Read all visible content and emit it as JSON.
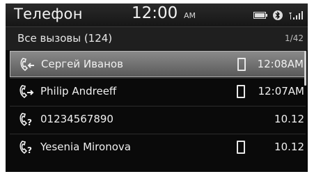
{
  "header": {
    "app_title": "Телефон",
    "time": "12:00",
    "ampm": "AM",
    "status_icons": [
      "battery-icon",
      "bluetooth-icon",
      "signal-icon"
    ]
  },
  "list": {
    "title": "Все вызовы (124)",
    "page": "1/42"
  },
  "calls": [
    {
      "name": "Сергей Иванов",
      "type": "incoming",
      "icon": "incoming-call-icon",
      "device": true,
      "time": "12:08AM",
      "selected": true
    },
    {
      "name": "Philip Andreeff",
      "type": "outgoing",
      "icon": "outgoing-call-icon",
      "device": true,
      "time": "12:07AM",
      "selected": false
    },
    {
      "name": "01234567890",
      "type": "missed",
      "icon": "missed-call-icon",
      "device": false,
      "time": "10.12",
      "selected": false
    },
    {
      "name": "Yesenia Mironova",
      "type": "missed",
      "icon": "missed-call-icon",
      "device": true,
      "time": "10.12",
      "selected": false
    }
  ],
  "colors": {
    "screen_bg": "#0a0a0a",
    "subheader_bg": "#1f1f1f",
    "selected_row": "#7a7a7a",
    "text": "#f0f0f0"
  }
}
